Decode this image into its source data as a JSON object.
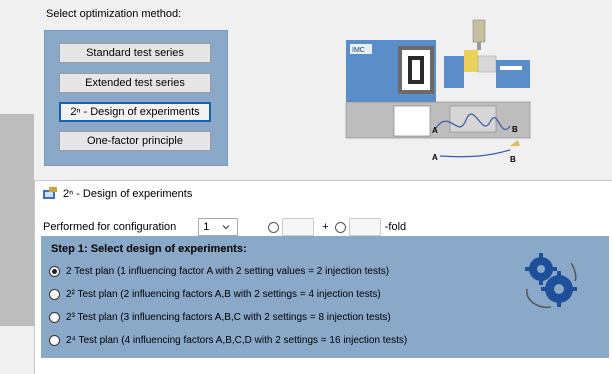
{
  "top": {
    "label": "Select optimization method:"
  },
  "methods": [
    {
      "label": "Standard test series",
      "selected": false
    },
    {
      "label": "Extended test series",
      "selected": false
    },
    {
      "label": "2ⁿ - Design of experiments",
      "selected": true
    },
    {
      "label": "One-factor principle",
      "selected": false
    }
  ],
  "machine": {
    "brand": "IMC",
    "marker_a": "A",
    "marker_b": "B",
    "marker_a2": "A",
    "marker_b2": "B"
  },
  "dialog": {
    "title": "2ⁿ - Design of experiments",
    "config_label": "Performed for configuration",
    "config_value": "1",
    "plus": "+",
    "fold": "-fold",
    "step_title": "Step 1: Select design of experiments:",
    "options": [
      {
        "label": "2 Test plan (1 influencing factor A with 2 setting values = 2 injection tests)",
        "checked": true
      },
      {
        "label": "2² Test plan (2 influencing factors A,B with 2 settings = 4 injection tests)",
        "checked": false
      },
      {
        "label": "2³ Test plan (3 influencing factors A,B,C with 2 settings = 8 injection tests)",
        "checked": false
      },
      {
        "label": "2⁴ Test plan (4 influencing factors A,B,C,D with 2 settings = 16 injection tests)",
        "checked": false
      }
    ]
  },
  "colors": {
    "panel": "#8aa8c8",
    "selection_border": "#1a5fb4",
    "gear": "#1e4f9a"
  },
  "icons": [
    "window-icon",
    "chevron-down-icon",
    "gears-icon",
    "machine-illustration"
  ]
}
